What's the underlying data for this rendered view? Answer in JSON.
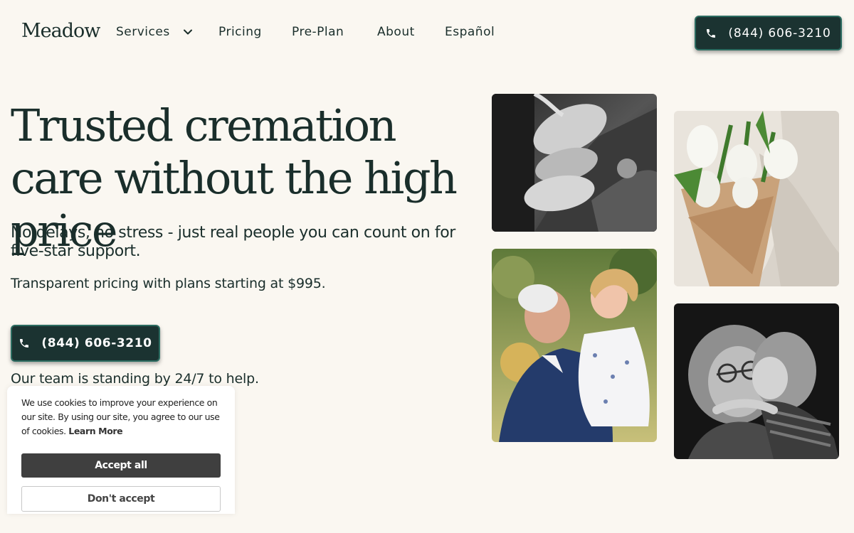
{
  "header": {
    "logo": "Meadow",
    "nav": [
      {
        "label": "Services",
        "dropdown": true
      },
      {
        "label": "Pricing"
      },
      {
        "label": "Pre-Plan"
      },
      {
        "label": "About"
      },
      {
        "label": "Español"
      }
    ],
    "phone": "(844) 606-3210"
  },
  "hero": {
    "headline": "Trusted cremation care without the high price",
    "subheadline": "No delays, no stress - just real people you can count on for five-star support.",
    "pricing": "Transparent pricing with plans starting at $995.",
    "phone": "(844) 606-3210",
    "availability": "Our team is standing by 24/7 to help."
  },
  "photos": [
    {
      "icon": "holding-hands-photo"
    },
    {
      "icon": "white-tulips-bouquet-photo"
    },
    {
      "icon": "grandfather-holding-toddler-photo"
    },
    {
      "icon": "grandmother-hug-photo"
    }
  ],
  "cookie_banner": {
    "text": "We use cookies to improve your experience on our site. By using our site, you agree to our use of cookies.",
    "learn_more": "Learn More",
    "accept": "Accept all",
    "decline": "Don't accept"
  },
  "colors": {
    "background": "#faf7f1",
    "primary_text": "#1a2e2b",
    "button": "#1b3331",
    "button_border": "#2b6b60",
    "cookie_accept": "#3f3f3f"
  }
}
